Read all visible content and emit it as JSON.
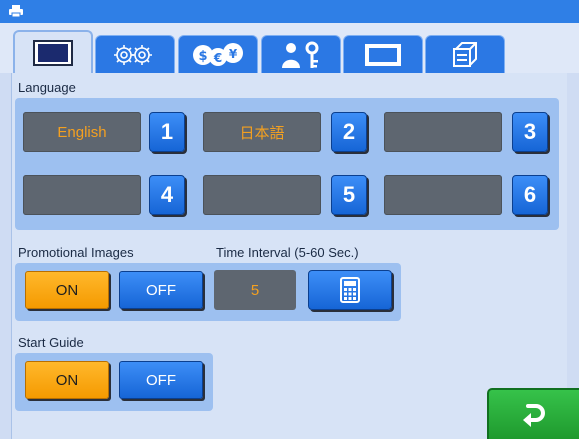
{
  "colors": {
    "titlebar": "#2f7fe6",
    "panel_bg": "#d7e3f6",
    "group_bg": "#9dc0f0",
    "field_bg": "#5e6670",
    "field_text": "#f4a020",
    "blue_button": "#1f78e6",
    "orange_button": "#f7a20f",
    "green_button": "#27a83a"
  },
  "tabs": [
    {
      "icon": "display-icon",
      "active": true
    },
    {
      "icon": "gears-icon",
      "active": false
    },
    {
      "icon": "currency-icon",
      "active": false
    },
    {
      "icon": "user-key-icon",
      "active": false
    },
    {
      "icon": "frame-icon",
      "active": false
    },
    {
      "icon": "device-icon",
      "active": false
    }
  ],
  "language": {
    "label": "Language",
    "slots": [
      {
        "name": "English",
        "number": "1"
      },
      {
        "name": "日本語",
        "number": "2"
      },
      {
        "name": "",
        "number": "3"
      },
      {
        "name": "",
        "number": "4"
      },
      {
        "name": "",
        "number": "5"
      },
      {
        "name": "",
        "number": "6"
      }
    ]
  },
  "promotional": {
    "label": "Promotional Images",
    "on_label": "ON",
    "off_label": "OFF",
    "selected": "ON"
  },
  "interval": {
    "label": "Time Interval (5-60 Sec.)",
    "value": "5",
    "calculator_icon": "calculator-icon"
  },
  "start_guide": {
    "label": "Start Guide",
    "on_label": "ON",
    "off_label": "OFF",
    "selected": "ON"
  },
  "back": {
    "icon": "return-arrow-icon"
  }
}
